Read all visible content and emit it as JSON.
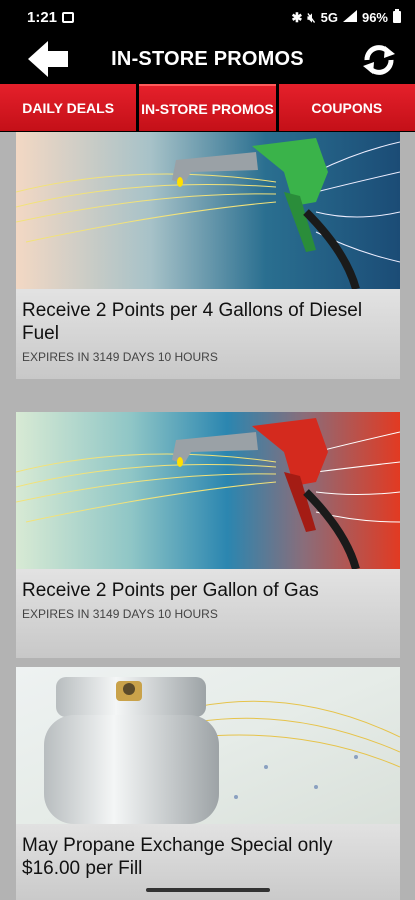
{
  "status": {
    "time": "1:21",
    "network": "5G",
    "battery": "96%"
  },
  "header": {
    "title": "IN-STORE PROMOS",
    "back_icon": "back-arrow-icon",
    "refresh_icon": "refresh-icon"
  },
  "tabs": [
    {
      "label": "DAILY DEALS",
      "active": false
    },
    {
      "label": "IN-STORE PROMOS",
      "active": true
    },
    {
      "label": "COUPONS",
      "active": false
    }
  ],
  "promos": [
    {
      "title": "Receive 2 Points per 4 Gallons of Diesel Fuel",
      "expiry": "EXPIRES IN 3149 DAYS 10 HOURS",
      "image": "green-fuel-nozzle-image"
    },
    {
      "title": "Receive 2 Points per Gallon of Gas",
      "expiry": "EXPIRES IN 3149 DAYS 10 HOURS",
      "image": "red-fuel-nozzle-image"
    },
    {
      "title": "May Propane Exchange Special only $16.00 per Fill",
      "image": "propane-tank-image"
    }
  ],
  "colors": {
    "tab_red": "#d8161f",
    "header_bg": "#000000",
    "nozzle_green": "#3ab34a",
    "nozzle_red": "#d42a1e"
  }
}
